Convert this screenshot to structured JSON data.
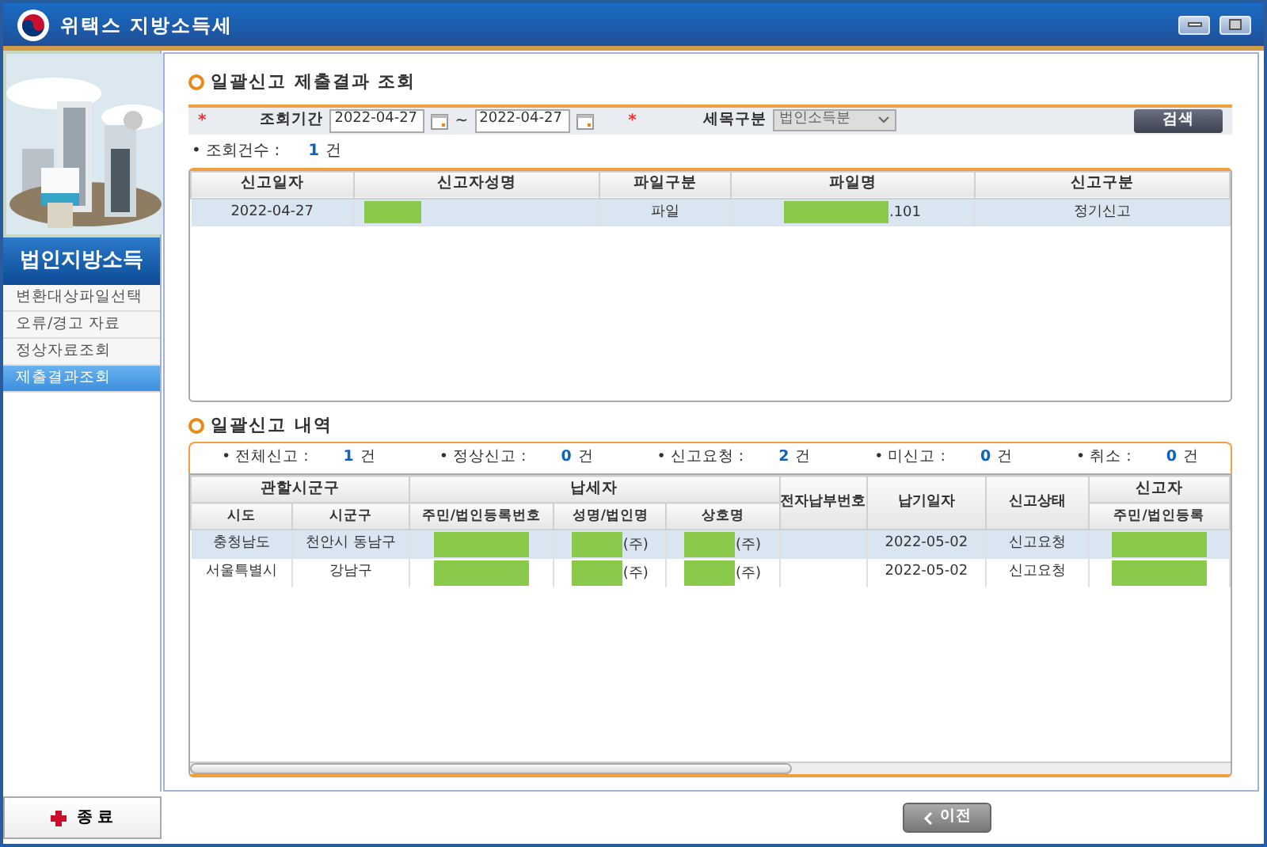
{
  "window": {
    "title": "위택스 지방소득세"
  },
  "sidebar": {
    "heading": "법인지방소득",
    "items": [
      {
        "label": "변환대상파일선택",
        "selected": false
      },
      {
        "label": "오류/경고 자료",
        "selected": false
      },
      {
        "label": "정상자료조회",
        "selected": false
      },
      {
        "label": "제출결과조회",
        "selected": true
      }
    ],
    "exit_button": "종 료"
  },
  "query": {
    "title": "일괄신고 제출결과 조회",
    "required_mark": "*",
    "period_label": "조회기간",
    "date_from": "2022-04-27",
    "separator": "~",
    "date_to": "2022-04-27",
    "category_mark": "*",
    "category_label": "세목구분",
    "category_value": "법인소득분",
    "search_button": "검색",
    "count_label": "• 조회건수 :",
    "count": "1",
    "count_unit": "건"
  },
  "results": {
    "columns": [
      "신고일자",
      "신고자성명",
      "파일구분",
      "파일명",
      "신고구분"
    ],
    "rows": [
      {
        "selected": true,
        "cells": [
          {
            "text": "2022-04-27"
          },
          {
            "redacted": true
          },
          {
            "text": "파일"
          },
          {
            "text": ".101",
            "redacted": true
          },
          {
            "text": "정기신고"
          }
        ]
      }
    ]
  },
  "details": {
    "title": "일괄신고 내역",
    "summary": [
      {
        "label": "• 전체신고 :",
        "count": "1",
        "unit": "건"
      },
      {
        "label": "• 정상신고 :",
        "count": "0",
        "unit": "건"
      },
      {
        "label": "• 신고요청 :",
        "count": "2",
        "unit": "건"
      },
      {
        "label": "• 미신고 :",
        "count": "0",
        "unit": "건"
      },
      {
        "label": "• 취소 :",
        "count": "0",
        "unit": "건"
      }
    ],
    "header_groups": [
      {
        "label": "관할시군구",
        "sub_columns": [
          "시도",
          "시군구"
        ]
      },
      {
        "label": "납세자",
        "sub_columns": [
          "주민/법인등록번호",
          "성명/법인명",
          "상호명"
        ]
      },
      {
        "label": "전자납부번호"
      },
      {
        "label": "납기일자"
      },
      {
        "label": "신고상태"
      },
      {
        "label": "신고자",
        "sub_columns": [
          "주민/법인등록"
        ]
      }
    ],
    "rows": [
      {
        "selected": true,
        "cells": [
          {
            "text": "충청남도"
          },
          {
            "text": "천안시 동남구"
          },
          {
            "redacted": true
          },
          {
            "text": "(주)",
            "redacted": true
          },
          {
            "text": "(주)",
            "redacted": true
          },
          {},
          {
            "text": "2022-05-02"
          },
          {
            "text": "신고요청"
          },
          {
            "redacted": true
          }
        ]
      },
      {
        "selected": false,
        "cells": [
          {
            "text": "서울특별시"
          },
          {
            "text": "강남구"
          },
          {
            "redacted": true
          },
          {
            "text": "(주)",
            "redacted": true
          },
          {
            "text": "(주)",
            "redacted": true
          },
          {},
          {
            "text": "2022-05-02"
          },
          {
            "text": "신고요청"
          },
          {
            "redacted": true
          }
        ]
      }
    ]
  },
  "back_button": "이전"
}
